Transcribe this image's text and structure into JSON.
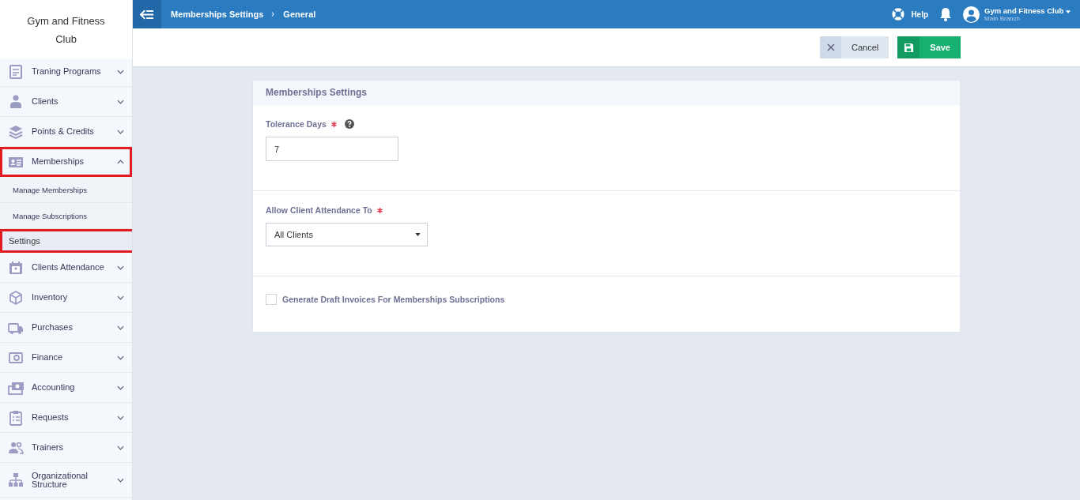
{
  "brand": {
    "name": "Gym and Fitness Club"
  },
  "sidebar": {
    "items": [
      {
        "label": "Traning Programs",
        "expanded": false,
        "highlighted": false
      },
      {
        "label": "Clients",
        "expanded": false,
        "highlighted": false
      },
      {
        "label": "Points & Credits",
        "expanded": false,
        "highlighted": false
      },
      {
        "label": "Memberships",
        "expanded": true,
        "highlighted": true,
        "children": [
          {
            "label": "Manage Memberships",
            "selected": false,
            "highlighted": false
          },
          {
            "label": "Manage Subscriptions",
            "selected": false,
            "highlighted": false
          },
          {
            "label": "Settings",
            "selected": true,
            "highlighted": true
          }
        ]
      },
      {
        "label": "Clients Attendance",
        "expanded": false,
        "highlighted": false
      },
      {
        "label": "Inventory",
        "expanded": false,
        "highlighted": false
      },
      {
        "label": "Purchases",
        "expanded": false,
        "highlighted": false
      },
      {
        "label": "Finance",
        "expanded": false,
        "highlighted": false
      },
      {
        "label": "Accounting",
        "expanded": false,
        "highlighted": false
      },
      {
        "label": "Requests",
        "expanded": false,
        "highlighted": false
      },
      {
        "label": "Trainers",
        "expanded": false,
        "highlighted": false
      },
      {
        "label": "Organizational Structure",
        "expanded": false,
        "highlighted": false
      }
    ]
  },
  "topbar": {
    "breadcrumb": [
      "Memberships Settings",
      "General"
    ],
    "help": "Help",
    "account": {
      "name": "Gym and Fitness Club",
      "branch": "Main Branch"
    }
  },
  "actions": {
    "cancel": "Cancel",
    "save": "Save"
  },
  "panel": {
    "title": "Memberships Settings",
    "sections": [
      {
        "kind": "input",
        "label": "Tolerance Days",
        "required": true,
        "help": true,
        "value": "7"
      },
      {
        "kind": "select",
        "label": "Allow Client Attendance To",
        "required": true,
        "help": false,
        "value": "All Clients"
      },
      {
        "kind": "checkbox",
        "label": "Generate Draft Invoices For Memberships Subscriptions",
        "checked": false
      }
    ]
  }
}
